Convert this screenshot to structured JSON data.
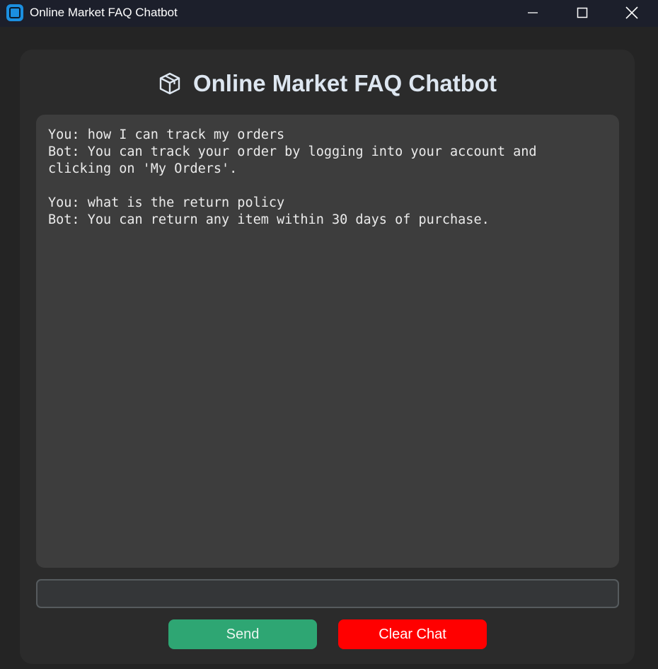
{
  "window": {
    "title": "Online Market FAQ Chatbot",
    "app_icon": "app-icon",
    "controls": [
      "minimize-icon",
      "maximize-icon",
      "close-icon"
    ]
  },
  "header": {
    "icon": "package-icon",
    "title": "Online Market FAQ Chatbot"
  },
  "chat": {
    "log": "You: how I can track my orders\nBot: You can track your order by logging into your account and clicking on 'My Orders'.\n\nYou: what is the return policy\nBot: You can return any item within 30 days of purchase."
  },
  "input": {
    "value": "",
    "placeholder": ""
  },
  "buttons": {
    "send_label": "Send",
    "clear_label": "Clear Chat"
  },
  "colors": {
    "send_button": "#2ea673",
    "clear_button": "#ff0000",
    "titlebar": "#1c1f2b",
    "background": "#242424",
    "chat_background": "#3d3d3d"
  }
}
